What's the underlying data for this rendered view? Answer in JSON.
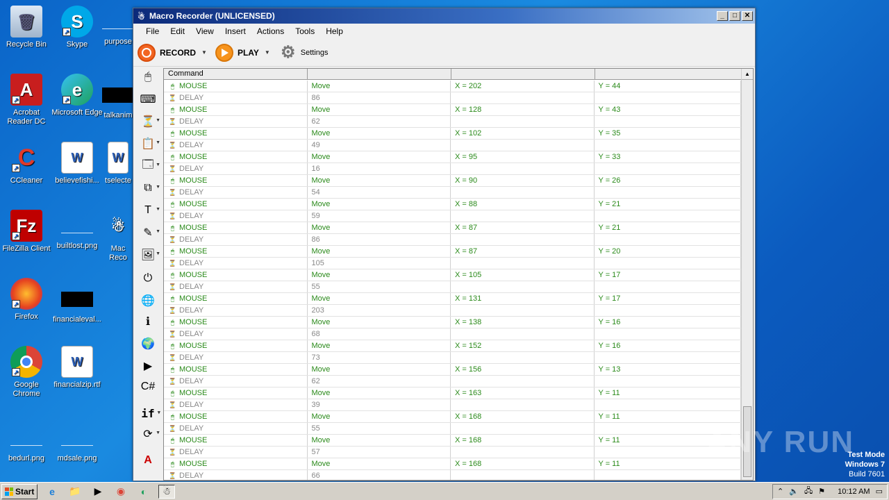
{
  "desktop": {
    "icons": [
      {
        "label": "Recycle Bin",
        "icon": "recycle-bin-icon"
      },
      {
        "label": "Skype",
        "icon": "skype-icon"
      },
      {
        "label": "purpose",
        "icon": "file-icon"
      },
      {
        "label": "Acrobat Reader DC",
        "icon": "acrobat-icon"
      },
      {
        "label": "Microsoft Edge",
        "icon": "edge-icon"
      },
      {
        "label": "talkanim",
        "icon": "file-icon"
      },
      {
        "label": "CCleaner",
        "icon": "ccleaner-icon"
      },
      {
        "label": "believefishi...",
        "icon": "word-doc-icon"
      },
      {
        "label": "tselecte",
        "icon": "word-doc-icon"
      },
      {
        "label": "FileZilla Client",
        "icon": "filezilla-icon"
      },
      {
        "label": "builtlost.png",
        "icon": "image-file-icon"
      },
      {
        "label": "Mac Reco",
        "icon": "macro-recorder-icon"
      },
      {
        "label": "Firefox",
        "icon": "firefox-icon"
      },
      {
        "label": "financialeval...",
        "icon": "file-icon"
      },
      {
        "label": "Google Chrome",
        "icon": "chrome-icon"
      },
      {
        "label": "financialzip.rtf",
        "icon": "word-doc-icon"
      },
      {
        "label": "bedurl.png",
        "icon": "image-file-icon"
      },
      {
        "label": "mdsale.png",
        "icon": "image-file-icon"
      }
    ]
  },
  "window": {
    "title": "Macro Recorder (UNLICENSED)",
    "menu": [
      "File",
      "Edit",
      "View",
      "Insert",
      "Actions",
      "Tools",
      "Help"
    ],
    "toolbar": {
      "record": "RECORD",
      "play": "PLAY",
      "settings": "Settings"
    },
    "grid": {
      "headers": [
        "Command",
        "",
        "",
        ""
      ],
      "rows": [
        {
          "type": "MOUSE",
          "action": "Move",
          "x": "X = 202",
          "y": "Y = 44"
        },
        {
          "type": "DELAY",
          "action": "86",
          "x": "",
          "y": ""
        },
        {
          "type": "MOUSE",
          "action": "Move",
          "x": "X = 128",
          "y": "Y = 43"
        },
        {
          "type": "DELAY",
          "action": "62",
          "x": "",
          "y": ""
        },
        {
          "type": "MOUSE",
          "action": "Move",
          "x": "X = 102",
          "y": "Y = 35"
        },
        {
          "type": "DELAY",
          "action": "49",
          "x": "",
          "y": ""
        },
        {
          "type": "MOUSE",
          "action": "Move",
          "x": "X = 95",
          "y": "Y = 33"
        },
        {
          "type": "DELAY",
          "action": "16",
          "x": "",
          "y": ""
        },
        {
          "type": "MOUSE",
          "action": "Move",
          "x": "X = 90",
          "y": "Y = 26"
        },
        {
          "type": "DELAY",
          "action": "54",
          "x": "",
          "y": ""
        },
        {
          "type": "MOUSE",
          "action": "Move",
          "x": "X = 88",
          "y": "Y = 21"
        },
        {
          "type": "DELAY",
          "action": "59",
          "x": "",
          "y": ""
        },
        {
          "type": "MOUSE",
          "action": "Move",
          "x": "X = 87",
          "y": "Y = 21"
        },
        {
          "type": "DELAY",
          "action": "86",
          "x": "",
          "y": ""
        },
        {
          "type": "MOUSE",
          "action": "Move",
          "x": "X = 87",
          "y": "Y = 20"
        },
        {
          "type": "DELAY",
          "action": "105",
          "x": "",
          "y": ""
        },
        {
          "type": "MOUSE",
          "action": "Move",
          "x": "X = 105",
          "y": "Y = 17"
        },
        {
          "type": "DELAY",
          "action": "55",
          "x": "",
          "y": ""
        },
        {
          "type": "MOUSE",
          "action": "Move",
          "x": "X = 131",
          "y": "Y = 17"
        },
        {
          "type": "DELAY",
          "action": "203",
          "x": "",
          "y": ""
        },
        {
          "type": "MOUSE",
          "action": "Move",
          "x": "X = 138",
          "y": "Y = 16"
        },
        {
          "type": "DELAY",
          "action": "68",
          "x": "",
          "y": ""
        },
        {
          "type": "MOUSE",
          "action": "Move",
          "x": "X = 152",
          "y": "Y = 16"
        },
        {
          "type": "DELAY",
          "action": "73",
          "x": "",
          "y": ""
        },
        {
          "type": "MOUSE",
          "action": "Move",
          "x": "X = 156",
          "y": "Y = 13"
        },
        {
          "type": "DELAY",
          "action": "62",
          "x": "",
          "y": ""
        },
        {
          "type": "MOUSE",
          "action": "Move",
          "x": "X = 163",
          "y": "Y = 11"
        },
        {
          "type": "DELAY",
          "action": "39",
          "x": "",
          "y": ""
        },
        {
          "type": "MOUSE",
          "action": "Move",
          "x": "X = 168",
          "y": "Y = 11"
        },
        {
          "type": "DELAY",
          "action": "55",
          "x": "",
          "y": ""
        },
        {
          "type": "MOUSE",
          "action": "Move",
          "x": "X = 168",
          "y": "Y = 11"
        },
        {
          "type": "DELAY",
          "action": "57",
          "x": "",
          "y": ""
        },
        {
          "type": "MOUSE",
          "action": "Move",
          "x": "X = 168",
          "y": "Y = 11"
        },
        {
          "type": "DELAY",
          "action": "66",
          "x": "",
          "y": ""
        }
      ]
    }
  },
  "taskbar": {
    "start": "Start",
    "clock": "10:12 AM"
  },
  "overlay": {
    "watermark": "ANY RUN",
    "test_mode_line1": "Test Mode",
    "test_mode_line2": "Windows 7",
    "test_mode_line3": "Build 7601"
  },
  "colors": {
    "mouse_text": "#2a8a1a",
    "delay_text": "#888888",
    "desktop_bg": "#0a64c8"
  }
}
